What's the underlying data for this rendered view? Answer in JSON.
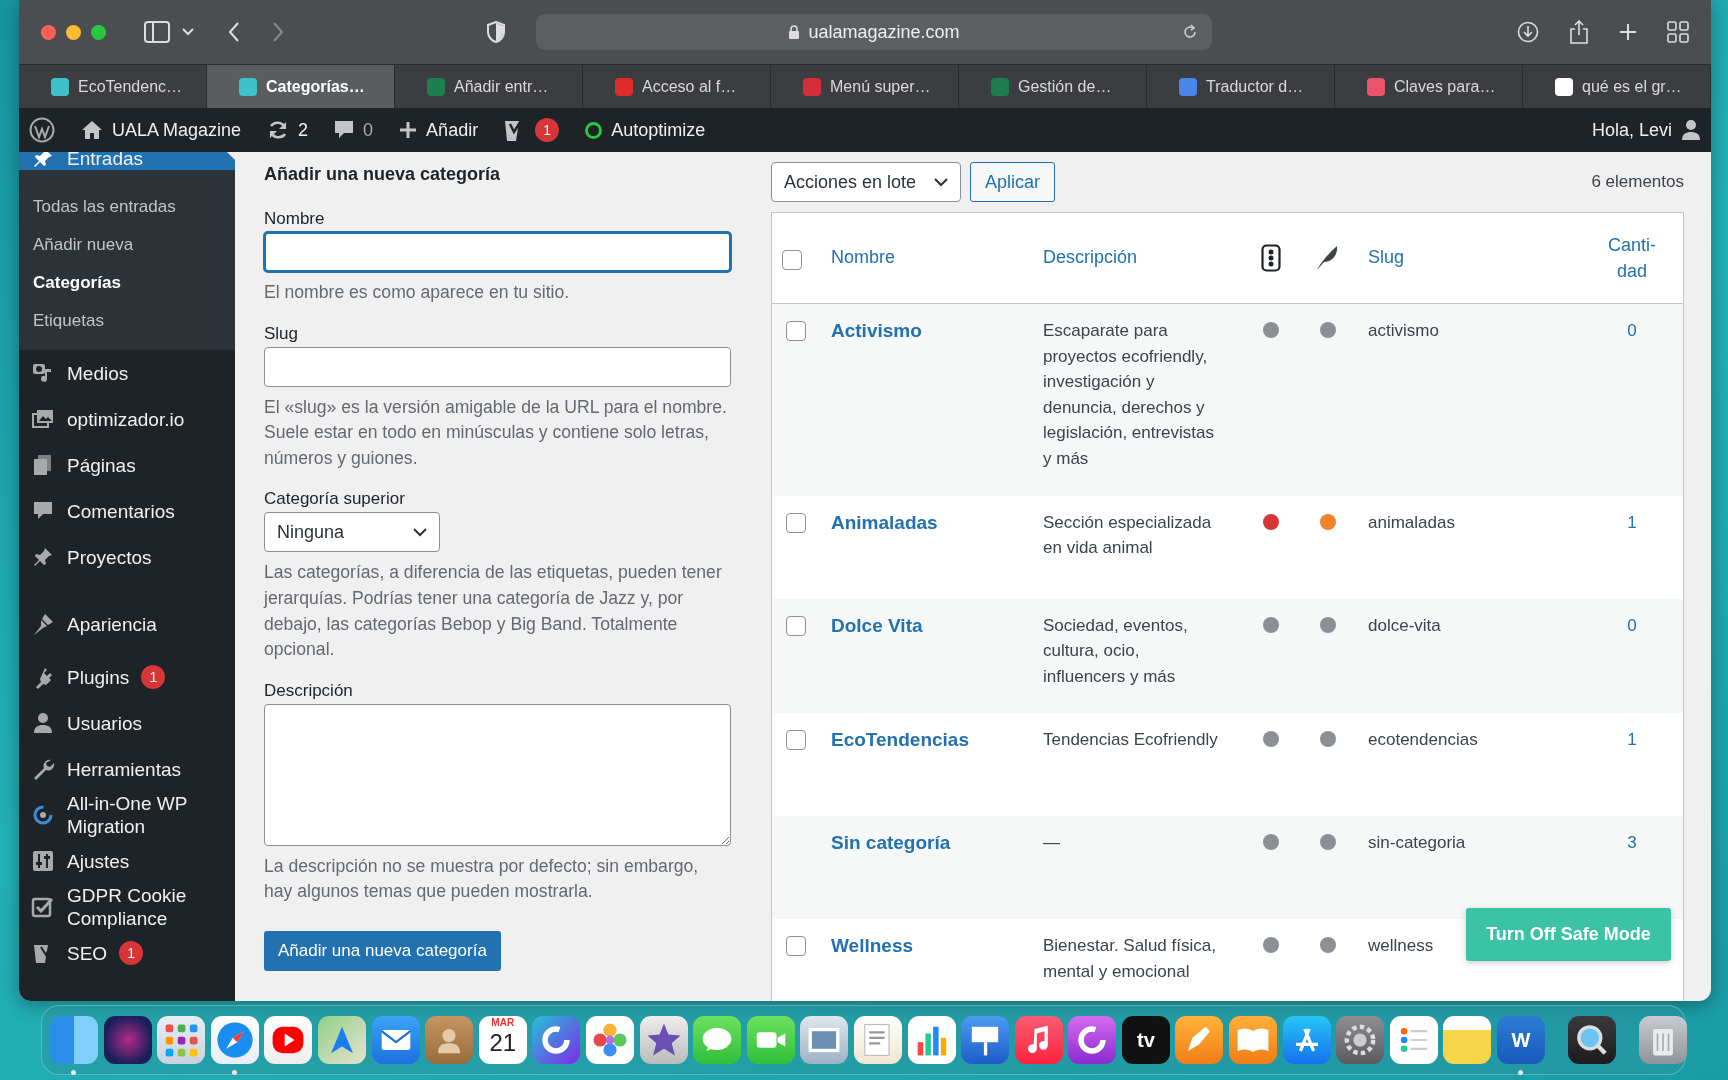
{
  "browser": {
    "url": "ualamagazine.com",
    "tabs": [
      {
        "label": "EcoTendenc…",
        "selected": false
      },
      {
        "label": "Categorías…",
        "selected": true
      },
      {
        "label": "Añadir entr…",
        "selected": false
      },
      {
        "label": "Acceso al f…",
        "selected": false
      },
      {
        "label": "Menú super…",
        "selected": false
      },
      {
        "label": "Gestión de…",
        "selected": false
      },
      {
        "label": "Traductor d…",
        "selected": false
      },
      {
        "label": "Claves para…",
        "selected": false
      },
      {
        "label": "qué es el gr…",
        "selected": false
      }
    ]
  },
  "admin_bar": {
    "site": "UALA Magazine",
    "updates": "2",
    "comments": "0",
    "add": "Añadir",
    "seo_badge": "1",
    "autoptimize": "Autoptimize",
    "greeting": "Hola, Levi"
  },
  "sidebar": {
    "items": [
      {
        "label": "Entradas",
        "selected": true,
        "children": [
          {
            "label": "Todas las entradas",
            "selected": false
          },
          {
            "label": "Añadir nueva",
            "selected": false
          },
          {
            "label": "Categorías",
            "selected": true
          },
          {
            "label": "Etiquetas",
            "selected": false
          }
        ]
      },
      {
        "label": "Medios",
        "selected": false
      },
      {
        "label": "optimizador.io",
        "selected": false
      },
      {
        "label": "Páginas",
        "selected": false
      },
      {
        "label": "Comentarios",
        "selected": false
      },
      {
        "label": "Proyectos",
        "selected": false
      },
      {
        "label": "Apariencia",
        "selected": false,
        "group_start": true
      },
      {
        "label": "Plugins",
        "selected": false,
        "badge": "1"
      },
      {
        "label": "Usuarios",
        "selected": false
      },
      {
        "label": "Herramientas",
        "selected": false
      },
      {
        "label": "All-in-One WP Migration",
        "selected": false
      },
      {
        "label": "Ajustes",
        "selected": false
      },
      {
        "label": "GDPR Cookie Compliance",
        "selected": false
      },
      {
        "label": "SEO",
        "selected": false,
        "badge": "1"
      }
    ]
  },
  "form": {
    "title": "Añadir una nueva categoría",
    "name": {
      "label": "Nombre",
      "focused": true,
      "help": "El nombre es como aparece en tu sitio."
    },
    "slug": {
      "label": "Slug",
      "focused": false,
      "help": "El «slug» es la versión amigable de la URL para el nombre. Suele estar en todo en minúsculas y contiene solo letras, números y guiones."
    },
    "parent": {
      "label": "Categoría superior",
      "value": "Ninguna",
      "help": "Las categorías, a diferencia de las etiquetas, pueden tener jerarquías. Podrías tener una categoría de Jazz y, por debajo, las categorías Bebop y Big Band. Totalmente opcional."
    },
    "description": {
      "label": "Descripción",
      "help": "La descripción no se muestra por defecto; sin embargo, hay algunos temas que pueden mostrarla."
    },
    "submit": "Añadir una nueva categoría"
  },
  "table": {
    "bulk_action": "Acciones en lote",
    "apply": "Aplicar",
    "count": "6 elementos",
    "header": {
      "checked": false,
      "columns": [
        "Nombre",
        "Descripción",
        "Slug",
        "Canti-dad"
      ]
    },
    "rows": [
      {
        "name": "Activismo",
        "description": "Escaparate para proyectos ecofriendly, investigación y denuncia, derechos y legislación, entrevistas y más",
        "dots": [
          {
            "color": "#8c8f94"
          },
          {
            "color": "#8c8f94"
          }
        ],
        "slug": "activismo",
        "count": "0",
        "selectable": true,
        "checked": false
      },
      {
        "name": "Animaladas",
        "description": "Sección especializada en vida animal",
        "dots": [
          {
            "color": "#d63638"
          },
          {
            "color": "#f0822d"
          }
        ],
        "slug": "animaladas",
        "count": "1",
        "selectable": true,
        "checked": false
      },
      {
        "name": "Dolce Vita",
        "description": "Sociedad, eventos, cultura, ocio, influencers y más",
        "dots": [
          {
            "color": "#8c8f94"
          },
          {
            "color": "#8c8f94"
          }
        ],
        "slug": "dolce-vita",
        "count": "0",
        "selectable": true,
        "checked": false
      },
      {
        "name": "EcoTendencias",
        "description": "Tendencias Ecofriendly",
        "dots": [
          {
            "color": "#8c8f94"
          },
          {
            "color": "#8c8f94"
          }
        ],
        "slug": "ecotendencias",
        "count": "1",
        "selectable": true,
        "checked": false
      },
      {
        "name": "Sin categoría",
        "description": "—",
        "dots": [
          {
            "color": "#8c8f94"
          },
          {
            "color": "#8c8f94"
          }
        ],
        "slug": "sin-categoria",
        "count": "3",
        "selectable": false
      },
      {
        "name": "Wellness",
        "description": "Bienestar. Salud física, mental y emocional",
        "dots": [
          {
            "color": "#8c8f94"
          },
          {
            "color": "#8c8f94"
          }
        ],
        "slug": "wellness",
        "count": "",
        "selectable": true,
        "checked": false
      }
    ]
  },
  "safe_mode_button": "Turn Off Safe Mode",
  "dock": [
    {
      "kind": "app",
      "running": true
    },
    {
      "kind": "app",
      "running": false
    },
    {
      "kind": "app",
      "running": false
    },
    {
      "kind": "app",
      "running": true
    },
    {
      "kind": "app",
      "running": false
    },
    {
      "kind": "app",
      "running": false
    },
    {
      "kind": "app",
      "running": false
    },
    {
      "kind": "app",
      "running": false
    },
    {
      "kind": "calendar",
      "running": false,
      "month": "MAR",
      "day": "21"
    },
    {
      "kind": "app",
      "running": false
    },
    {
      "kind": "app",
      "running": false
    },
    {
      "kind": "app",
      "running": false
    },
    {
      "kind": "app",
      "running": false
    },
    {
      "kind": "app",
      "running": false
    },
    {
      "kind": "app",
      "running": false
    },
    {
      "kind": "app",
      "running": false
    },
    {
      "kind": "app",
      "running": false
    },
    {
      "kind": "app",
      "running": false
    },
    {
      "kind": "app",
      "running": false
    },
    {
      "kind": "app",
      "running": false
    },
    {
      "kind": "labeled",
      "running": false,
      "label": "tv"
    },
    {
      "kind": "app",
      "running": false
    },
    {
      "kind": "app",
      "running": false
    },
    {
      "kind": "app",
      "running": false
    },
    {
      "kind": "app",
      "running": false
    },
    {
      "kind": "app",
      "running": false
    },
    {
      "kind": "app",
      "running": false
    },
    {
      "kind": "labeled",
      "running": true,
      "label": "W"
    },
    {
      "kind": "separator"
    },
    {
      "kind": "app",
      "running": false
    },
    {
      "kind": "separator"
    },
    {
      "kind": "trash",
      "running": false
    }
  ]
}
